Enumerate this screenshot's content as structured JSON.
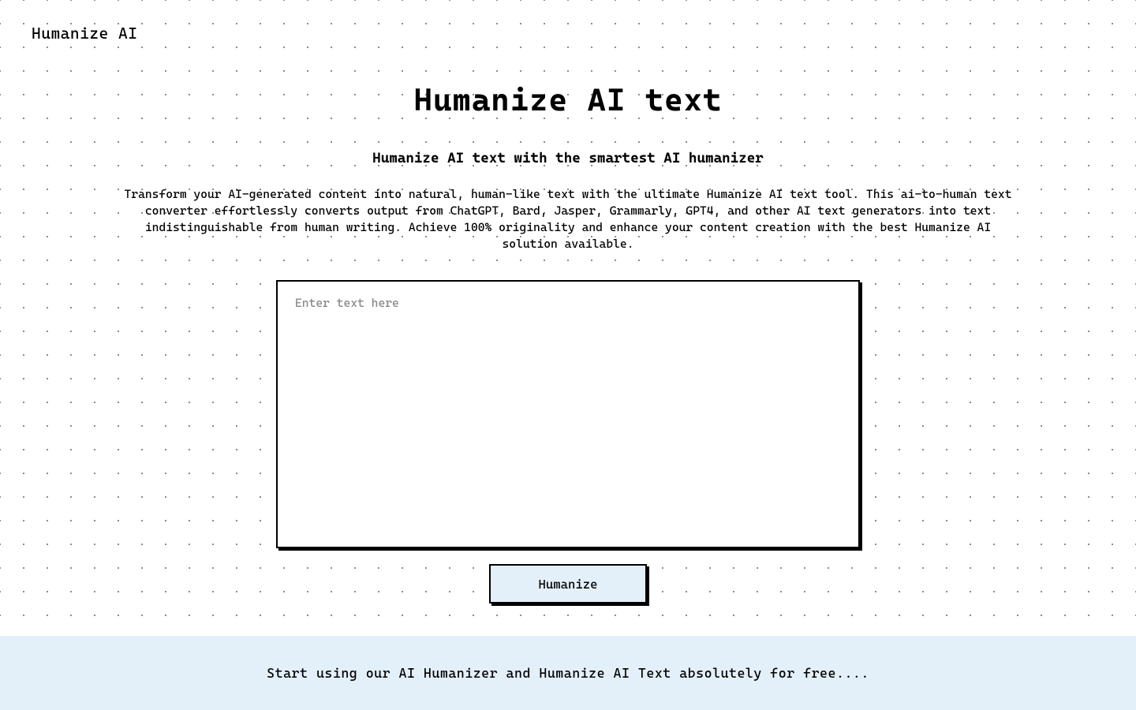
{
  "header": {
    "logo": "Humanize AI"
  },
  "main": {
    "title": "Humanize AI text",
    "subtitle": "Humanize AI text with the smartest AI humanizer",
    "description": "Transform your AI-generated content into natural, human-like text with the ultimate Humanize AI text tool. This ai-to-human text converter effortlessly converts output from ChatGPT, Bard, Jasper, Grammarly, GPT4, and other AI text generators into text indistinguishable from human writing. Achieve 100% originality and enhance your content creation with the best Humanize AI solution available.",
    "textarea_placeholder": "Enter text here",
    "textarea_value": "",
    "button_label": "Humanize"
  },
  "banner": {
    "text": "Start using our AI Humanizer and Humanize AI Text absolutely for free...."
  }
}
